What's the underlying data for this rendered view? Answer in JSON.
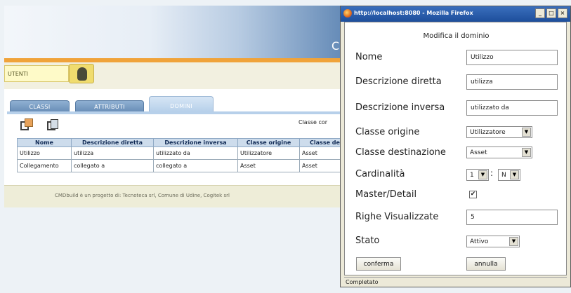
{
  "app": {
    "header_letter": "C",
    "user": {
      "label": "UTENTI",
      "avatar_icon": "user-icon"
    },
    "tabs": [
      {
        "label": "CLASSI"
      },
      {
        "label": "ATTRIBUTI"
      },
      {
        "label": "DOMINI",
        "active": true
      }
    ],
    "toolbar": {
      "add_icon": "add-domain-icon",
      "copy_icon": "copy-icon",
      "class_filter_label": "Classe cor"
    },
    "grid": {
      "columns": [
        "Nome",
        "Descrizione diretta",
        "Descrizione inversa",
        "Classe origine",
        "Classe de"
      ],
      "rows": [
        [
          "Utilizzo",
          "utilizza",
          "utilizzato da",
          "Utilizzatore",
          "Asset"
        ],
        [
          "Collegamento",
          "collegato a",
          "collegato a",
          "Asset",
          "Asset"
        ]
      ]
    },
    "footer": "CMDbuild è un progetto di: Tecnoteca srl, Comune di Udine, Cogitek srl"
  },
  "popup": {
    "window_title": "http://localhost:8080 - Mozilla Firefox",
    "window_buttons": {
      "minimize": "_",
      "maximize": "□",
      "close": "×"
    },
    "heading": "Modifica il dominio",
    "fields": {
      "nome": {
        "label": "Nome",
        "value": "Utilizzo"
      },
      "descrizione_diretta": {
        "label": "Descrizione diretta",
        "value": "utilizza"
      },
      "descrizione_inversa": {
        "label": "Descrizione inversa",
        "value": "utilizzato da"
      },
      "classe_origine": {
        "label": "Classe origine",
        "value": "Utilizzatore"
      },
      "classe_destinazione": {
        "label": "Classe destinazione",
        "value": "Asset"
      },
      "cardinalita": {
        "label": "Cardinalità",
        "value_left": "1",
        "separator": ":",
        "value_right": "N"
      },
      "master_detail": {
        "label": "Master/Detail",
        "checked": true,
        "check_mark": "✔"
      },
      "righe_visualizzate": {
        "label": "Righe Visualizzate",
        "value": "5"
      },
      "stato": {
        "label": "Stato",
        "value": "Attivo"
      }
    },
    "dropdown_arrow": "▼",
    "buttons": {
      "confirm": "conferma",
      "cancel": "annulla"
    },
    "status": "Completato"
  },
  "colors": {
    "header_gradient_end": "#5f86b4",
    "accent_orange": "#f0a33a",
    "titlebar_blue": "#1d4e9b",
    "table_header_bg": "#cddcec"
  }
}
